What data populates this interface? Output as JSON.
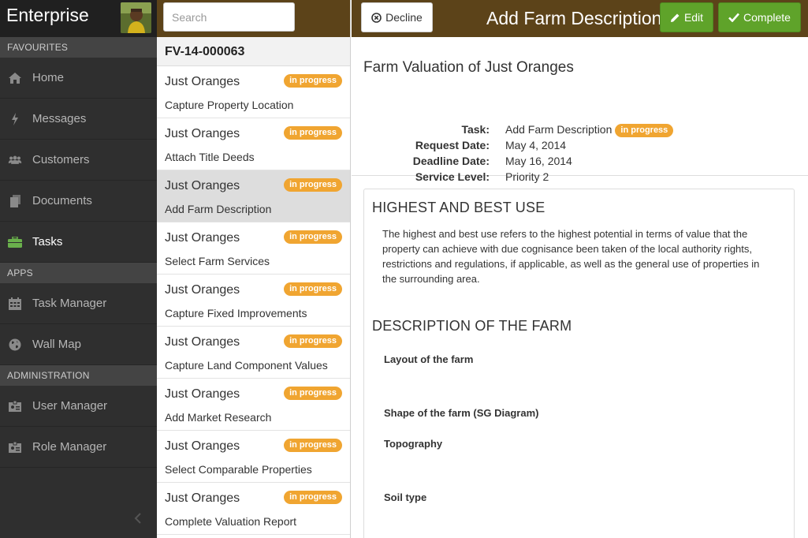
{
  "sidebar": {
    "brand": "Enterprise",
    "sections": {
      "favourites": "FAVOURITES",
      "apps": "APPS",
      "administration": "ADMINISTRATION"
    },
    "items": {
      "home": "Home",
      "messages": "Messages",
      "customers": "Customers",
      "documents": "Documents",
      "tasks": "Tasks",
      "task_manager": "Task Manager",
      "wall_map": "Wall Map",
      "user_manager": "User Manager",
      "role_manager": "Role Manager"
    },
    "active_item": "Tasks"
  },
  "list": {
    "search_placeholder": "Search",
    "case_id": "FV-14-000063",
    "tasks": [
      {
        "title": "Just Oranges",
        "subtitle": "Capture Property Location",
        "status": "in progress"
      },
      {
        "title": "Just Oranges",
        "subtitle": "Attach Title Deeds",
        "status": "in progress"
      },
      {
        "title": "Just Oranges",
        "subtitle": "Add Farm Description",
        "status": "in progress"
      },
      {
        "title": "Just Oranges",
        "subtitle": "Select Farm Services",
        "status": "in progress"
      },
      {
        "title": "Just Oranges",
        "subtitle": "Capture Fixed Improvements",
        "status": "in progress"
      },
      {
        "title": "Just Oranges",
        "subtitle": "Capture Land Component Values",
        "status": "in progress"
      },
      {
        "title": "Just Oranges",
        "subtitle": "Add Market Research",
        "status": "in progress"
      },
      {
        "title": "Just Oranges",
        "subtitle": "Select Comparable Properties",
        "status": "in progress"
      },
      {
        "title": "Just Oranges",
        "subtitle": "Complete Valuation Report",
        "status": "in progress"
      }
    ],
    "selected_index": 2
  },
  "toolbar": {
    "decline_label": "Decline",
    "title": "Add Farm Description",
    "edit_label": "Edit",
    "complete_label": "Complete"
  },
  "summary": {
    "heading": "Farm Valuation of Just Oranges",
    "task_key": "Task:",
    "task_value": "Add Farm Description",
    "task_status": "in progress",
    "request_key": "Request Date:",
    "request_value": "May 4, 2014",
    "deadline_key": "Deadline Date:",
    "deadline_value": "May 16, 2014",
    "service_key": "Service Level:",
    "service_value": "Priority 2"
  },
  "content": {
    "hbu_heading": "HIGHEST AND BEST USE",
    "hbu_text": "The highest and best use refers to the highest potential in terms of value that the property can achieve with due cognisance been taken of the local authority rights, restrictions and regulations, if applicable, as well as the general use of properties in the surrounding area.",
    "farm_heading": "DESCRIPTION OF THE FARM",
    "fields": {
      "layout": "Layout of the farm",
      "shape": "Shape of the farm (SG Diagram)",
      "topography": "Topography",
      "soil": "Soil type"
    }
  },
  "colors": {
    "sidebar_bg": "#2f2f2f",
    "header_brown": "#5c4319",
    "badge_orange": "#f0a531",
    "button_green": "#5fa32a",
    "tasks_icon_green": "#6ab04c"
  }
}
